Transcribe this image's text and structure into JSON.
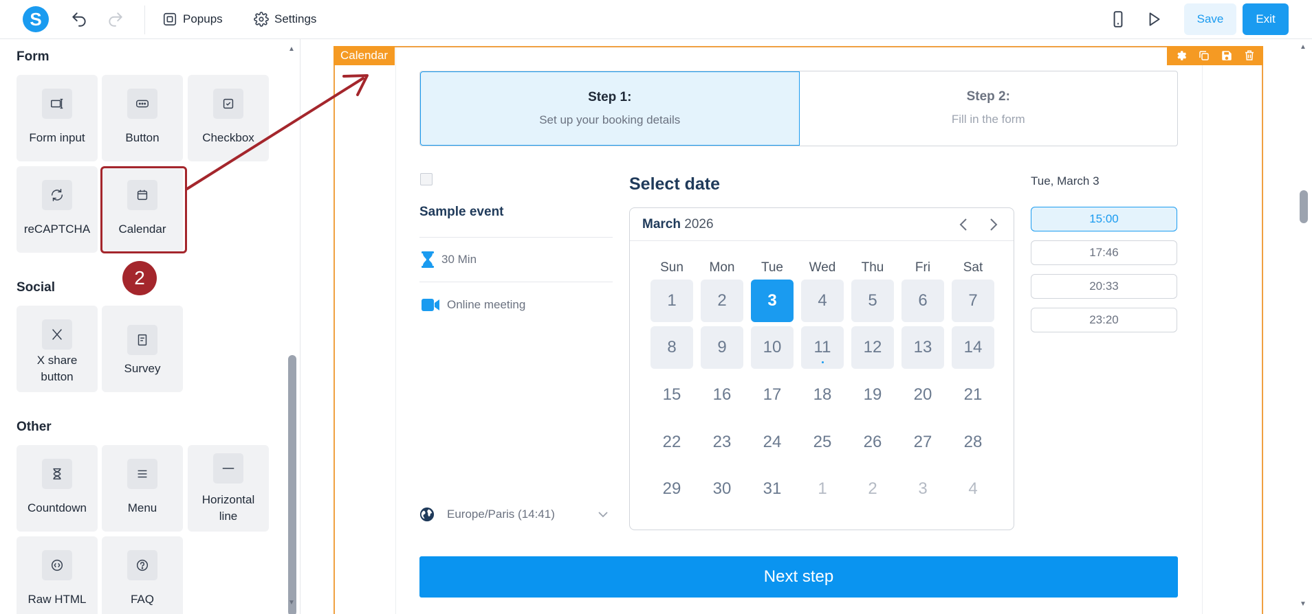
{
  "toolbar": {
    "logo_letter": "S",
    "popups_label": "Popups",
    "settings_label": "Settings",
    "save_label": "Save",
    "exit_label": "Exit"
  },
  "sidebar": {
    "sections": {
      "form": "Form",
      "social": "Social",
      "other": "Other"
    },
    "widgets": {
      "form_input": "Form input",
      "button": "Button",
      "checkbox": "Checkbox",
      "recaptcha": "reCAPTCHA",
      "calendar": "Calendar",
      "x_share_1": "X share",
      "x_share_2": "button",
      "survey": "Survey",
      "countdown": "Countdown",
      "menu": "Menu",
      "hline_1": "Horizontal",
      "hline_2": "line",
      "raw_html": "Raw HTML",
      "faq": "FAQ"
    }
  },
  "annotation": {
    "badge": "2"
  },
  "canvas": {
    "block_tag": "Calendar",
    "step1_title": "Step 1:",
    "step1_sub": "Set up your booking details",
    "step2_title": "Step 2:",
    "step2_sub": "Fill in the form",
    "event_name": "Sample event",
    "duration": "30 Min",
    "location": "Online meeting",
    "timezone": "Europe/Paris (14:41)",
    "select_date": "Select date",
    "month": "March",
    "year": "2026",
    "weekdays": [
      "Sun",
      "Mon",
      "Tue",
      "Wed",
      "Thu",
      "Fri",
      "Sat"
    ],
    "days": [
      [
        "1",
        "2",
        "3",
        "4",
        "5",
        "6",
        "7"
      ],
      [
        "8",
        "9",
        "10",
        "11",
        "12",
        "13",
        "14"
      ],
      [
        "15",
        "16",
        "17",
        "18",
        "19",
        "20",
        "21"
      ],
      [
        "22",
        "23",
        "24",
        "25",
        "26",
        "27",
        "28"
      ],
      [
        "29",
        "30",
        "31",
        "1",
        "2",
        "3",
        "4"
      ]
    ],
    "selected_day": "3",
    "slot_date": "Tue, March 3",
    "slots": [
      "15:00",
      "17:46",
      "20:33",
      "23:20"
    ],
    "next_step": "Next step",
    "colors": {
      "accent": "#1a9bf0",
      "block_border": "#f59a23",
      "annotation": "#a4262c"
    }
  }
}
